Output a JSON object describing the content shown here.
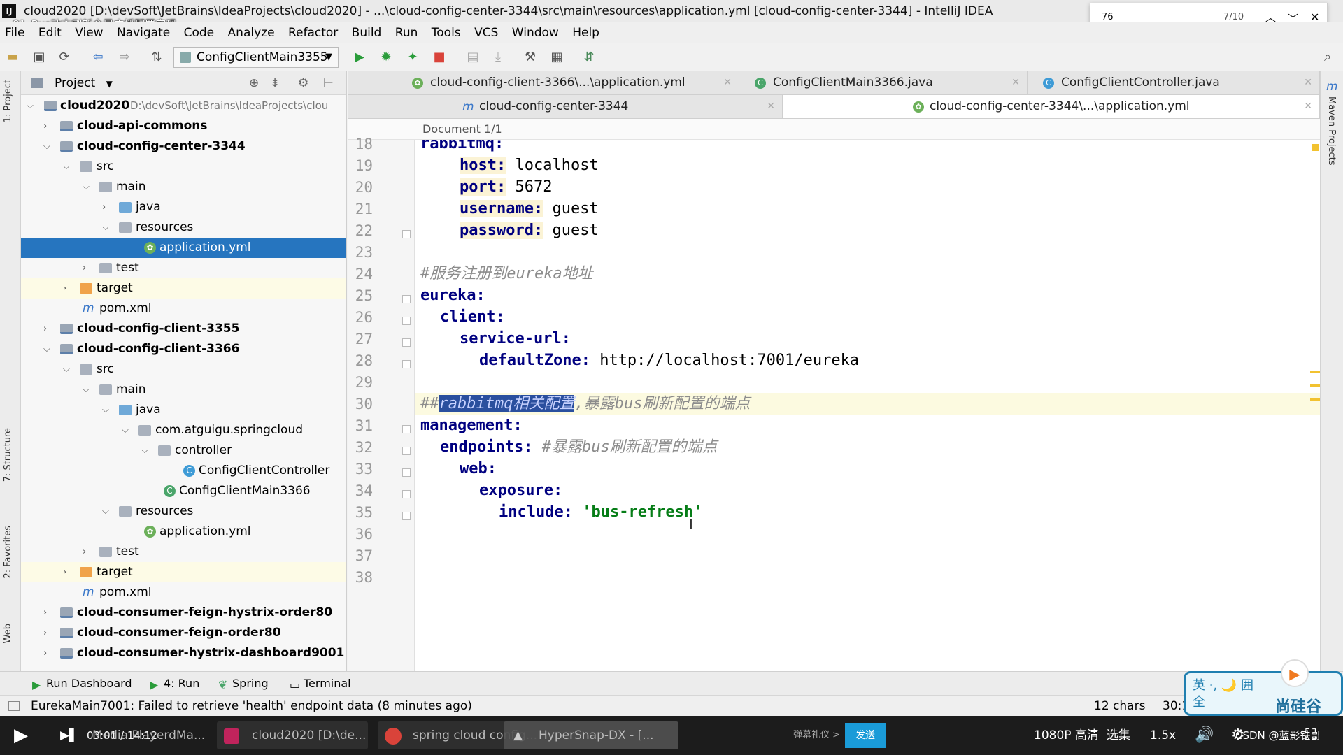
{
  "window": {
    "title": "cloud2020 [D:\\devSoft\\JetBrains\\IdeaProjects\\cloud2020] - ...\\cloud-config-center-3344\\src\\main\\resources\\application.yml [cloud-config-center-3344] - IntelliJ IDEA",
    "video_overlay_title": "81_Bus动态刷新全局广播配置实现"
  },
  "find": {
    "query": "76",
    "count": "7/10"
  },
  "menu": [
    "File",
    "Edit",
    "View",
    "Navigate",
    "Code",
    "Analyze",
    "Refactor",
    "Build",
    "Run",
    "Tools",
    "VCS",
    "Window",
    "Help"
  ],
  "toolbar": {
    "run_config": "ConfigClientMain3355"
  },
  "left_tabs": {
    "project": "1: Project",
    "structure": "7: Structure",
    "favorites": "2: Favorites",
    "web": "Web"
  },
  "right_tabs": {
    "maven": "Maven Projects"
  },
  "project_panel": {
    "title": "Project",
    "tree": [
      {
        "label": "cloud2020",
        "path": "D:\\devSoft\\JetBrains\\IdeaProjects\\clou",
        "bold": true
      },
      {
        "label": "cloud-api-commons",
        "bold": true
      },
      {
        "label": "cloud-config-center-3344",
        "bold": true
      },
      {
        "label": "src"
      },
      {
        "label": "main"
      },
      {
        "label": "java"
      },
      {
        "label": "resources"
      },
      {
        "label": "application.yml"
      },
      {
        "label": "test"
      },
      {
        "label": "target"
      },
      {
        "label": "pom.xml"
      },
      {
        "label": "cloud-config-client-3355",
        "bold": true
      },
      {
        "label": "cloud-config-client-3366",
        "bold": true
      },
      {
        "label": "src"
      },
      {
        "label": "main"
      },
      {
        "label": "java"
      },
      {
        "label": "com.atguigu.springcloud"
      },
      {
        "label": "controller"
      },
      {
        "label": "ConfigClientController"
      },
      {
        "label": "ConfigClientMain3366"
      },
      {
        "label": "resources"
      },
      {
        "label": "application.yml"
      },
      {
        "label": "test"
      },
      {
        "label": "target"
      },
      {
        "label": "pom.xml"
      },
      {
        "label": "cloud-consumer-feign-hystrix-order80",
        "bold": true
      },
      {
        "label": "cloud-consumer-feign-order80",
        "bold": true
      },
      {
        "label": "cloud-consumer-hystrix-dashboard9001",
        "bold": true
      }
    ]
  },
  "editor_tabs_row1": [
    {
      "label": "cloud-config-client-3366\\...\\application.yml"
    },
    {
      "label": "ConfigClientMain3366.java"
    },
    {
      "label": "ConfigClientController.java"
    }
  ],
  "editor_tabs_row2": [
    {
      "label": "cloud-config-center-3344"
    },
    {
      "label": "cloud-config-center-3344\\...\\application.yml"
    }
  ],
  "breadcrumb": "Document 1/1",
  "editor": {
    "line_numbers": [
      "18",
      "19",
      "20",
      "21",
      "22",
      "23",
      "24",
      "25",
      "26",
      "27",
      "28",
      "29",
      "30",
      "31",
      "32",
      "33",
      "34",
      "35",
      "36",
      "37",
      "38"
    ],
    "lines": {
      "l18": "rabbitmq:",
      "l19k": "host:",
      "l19v": " localhost",
      "l20k": "port:",
      "l20v": " 5672",
      "l21k": "username:",
      "l21v": " guest",
      "l22k": "password:",
      "l22v": " guest",
      "l24": "#服务注册到eureka地址",
      "l25": "eureka:",
      "l26": "client:",
      "l27": "service-url:",
      "l28k": "defaultZone:",
      "l28v": " http://localhost:7001/eureka",
      "l30a": "##",
      "l30sel": "rabbitmq相关配置",
      "l30b": ",暴露bus刷新配置的端点",
      "l31": "management:",
      "l32k": "endpoints:",
      "l32c": " #暴露bus刷新配置的端点",
      "l33": "web:",
      "l34": "exposure:",
      "l35k": "include:",
      "l35v": "'bus-refresh'"
    }
  },
  "tool_windows": [
    "Run Dashboard",
    "4: Run",
    "Spring",
    "Terminal"
  ],
  "status": {
    "message": "EurekaMain7001: Failed to retrieve 'health' endpoint data (8 minutes ago)",
    "chars": "12 chars",
    "position": "30:1"
  },
  "player": {
    "time": "03:01 / 14:12",
    "tasks": [
      "Media PlayerdMa...",
      "cloud2020 [D:\\de...",
      "spring cloud config...",
      "HyperSnap-DX - [..."
    ],
    "danmaku_hint": "弹幕礼仪 >",
    "send": "发送",
    "quality": "1080P 高清",
    "episodes": "选集",
    "speed": "1.5x",
    "watermark": "CSDN @蓝影铁哥"
  },
  "brand": {
    "ime": "英 ·, 🌙 囲 全",
    "name": "尚硅谷"
  },
  "colors": {
    "selection": "#2675bf",
    "keyword": "#000080",
    "string": "#067d17",
    "comment": "#8c8c8c"
  }
}
